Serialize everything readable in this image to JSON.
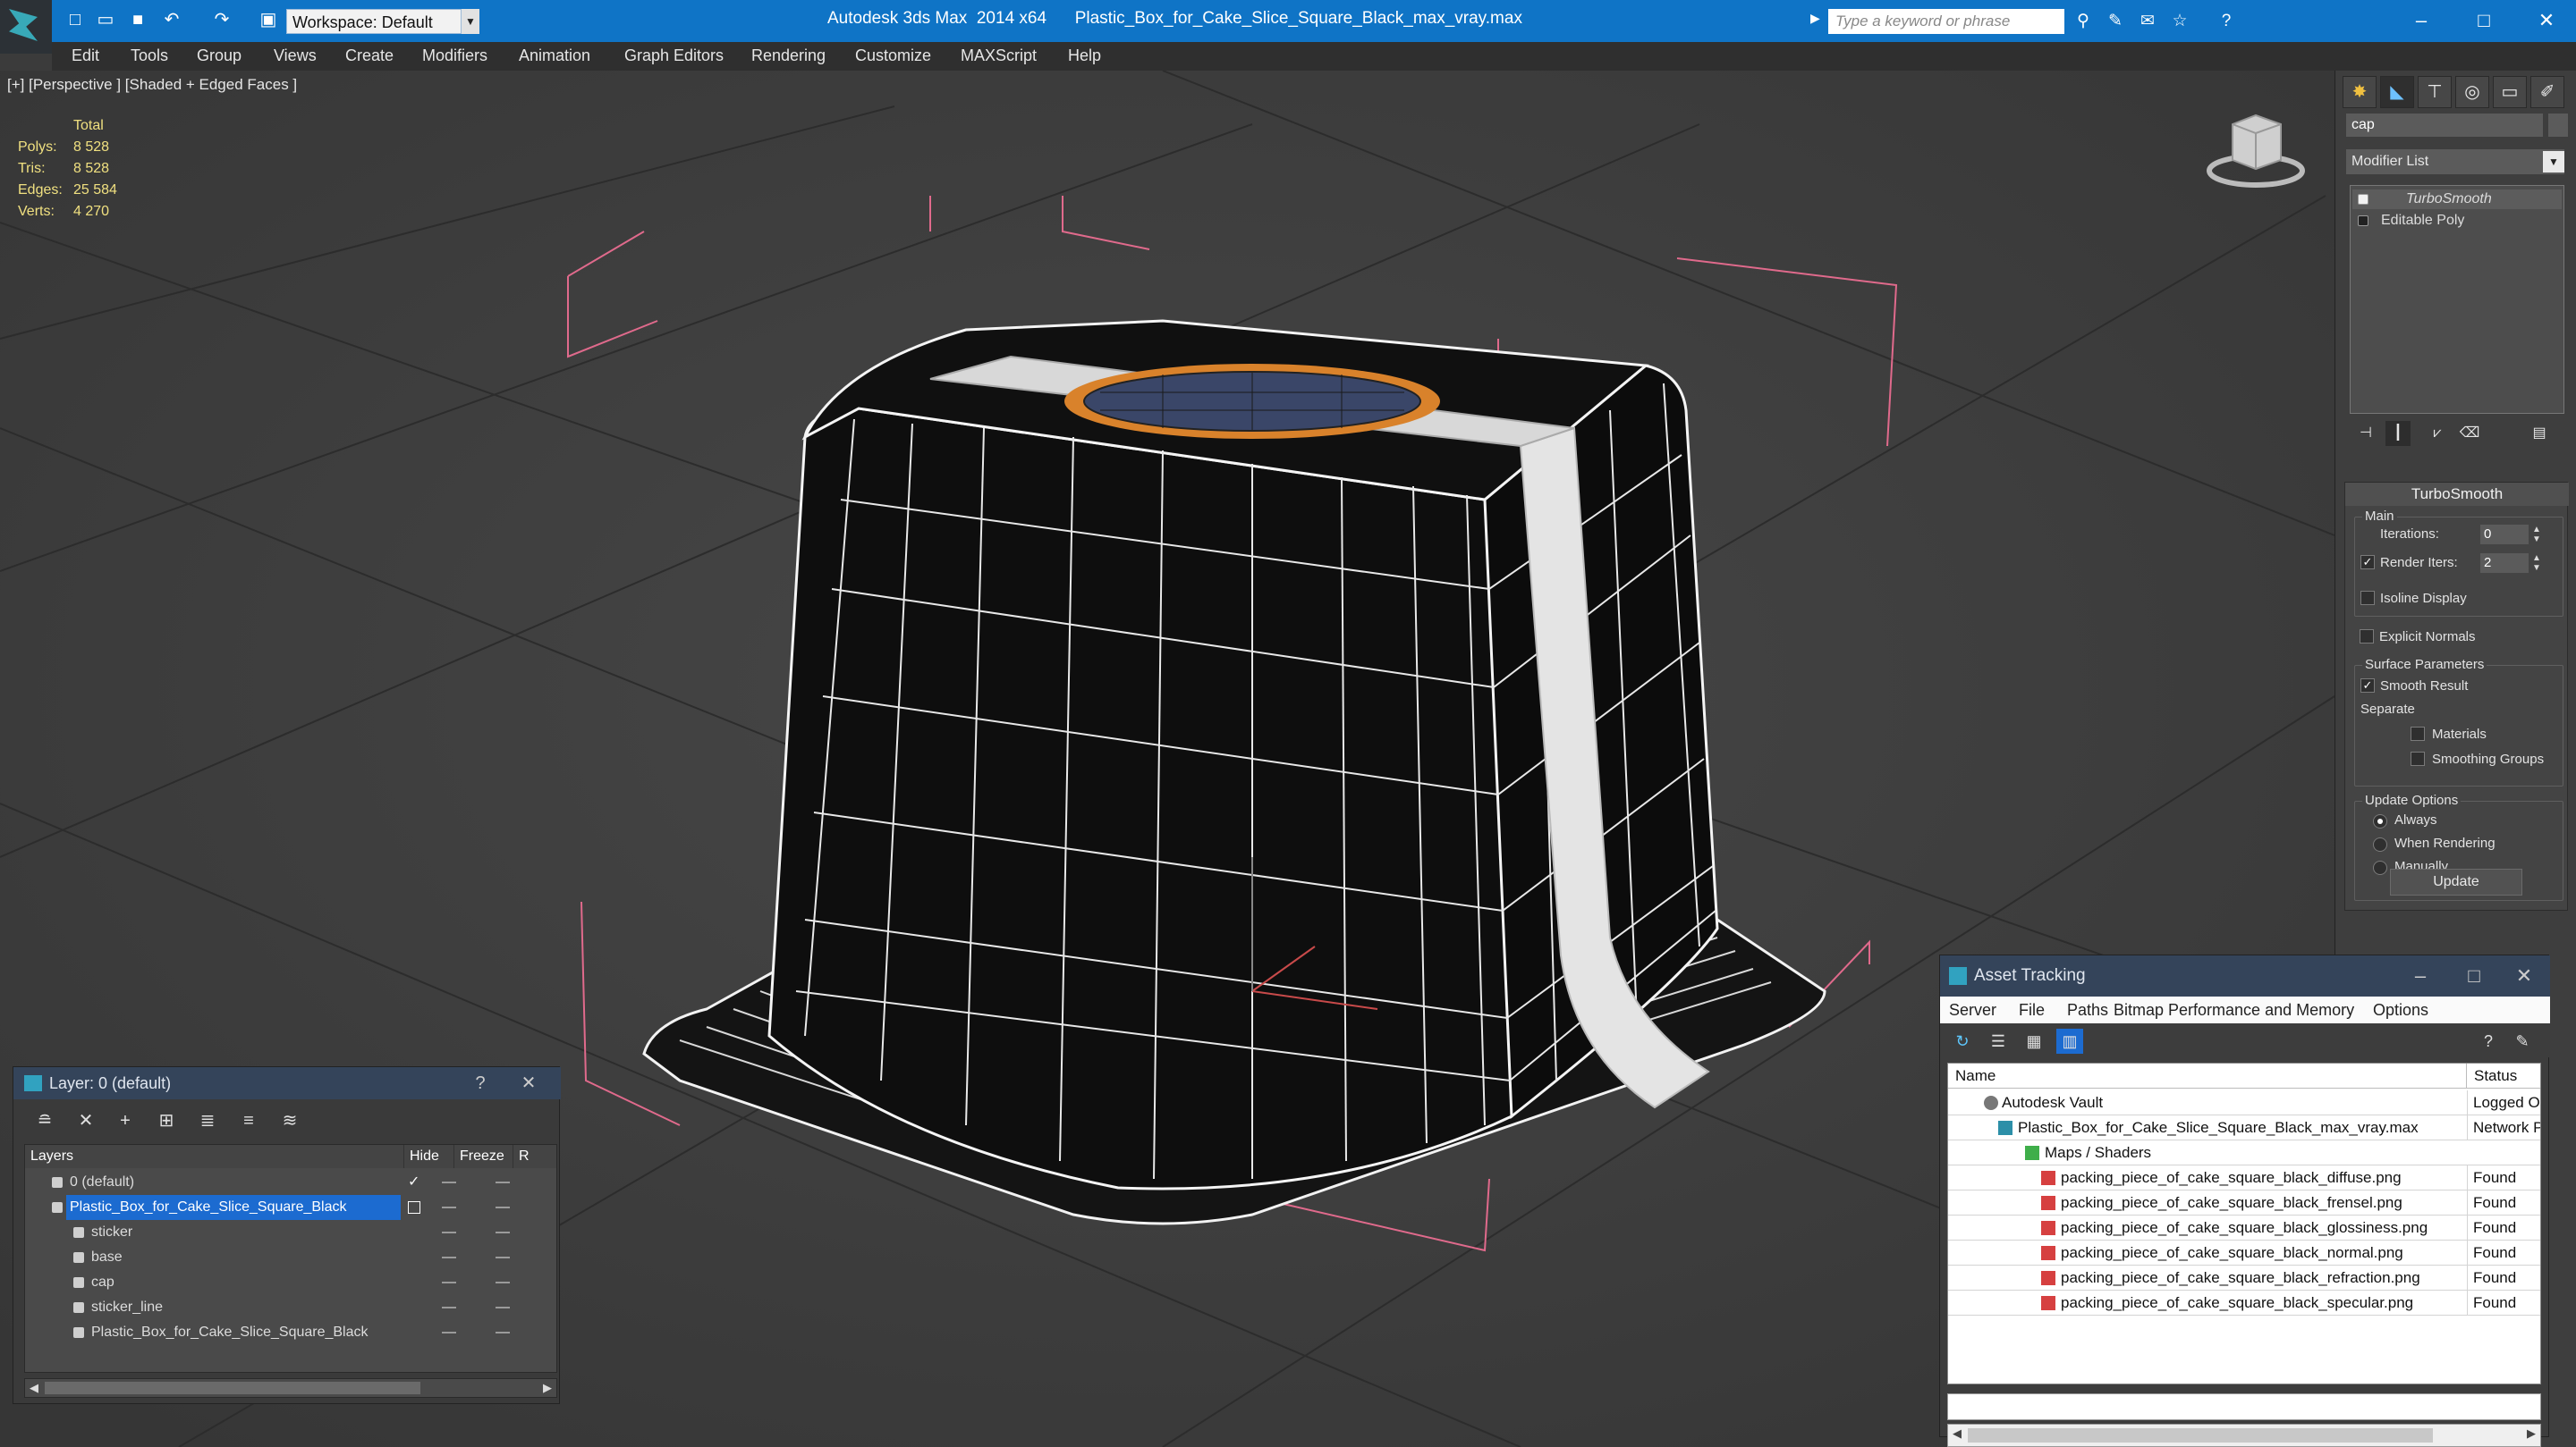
{
  "titlebar": {
    "workspace": "Workspace: Default",
    "app_title": "Autodesk 3ds Max  2014 x64      Plastic_Box_for_Cake_Slice_Square_Black_max_vray.max",
    "search_placeholder": "Type a keyword or phrase",
    "accent_color": "#0f74c6"
  },
  "menu": [
    "Edit",
    "Tools",
    "Group",
    "Views",
    "Create",
    "Modifiers",
    "Animation",
    "Graph Editors",
    "Rendering",
    "Customize",
    "MAXScript",
    "Help"
  ],
  "viewport": {
    "label": "[+] [Perspective ] [Shaded + Edged Faces ]",
    "stats": {
      "total_label": "Total",
      "rows": [
        {
          "key": "Polys:",
          "value": "8 528"
        },
        {
          "key": "Tris:",
          "value": "8 528"
        },
        {
          "key": "Edges:",
          "value": "25 584"
        },
        {
          "key": "Verts:",
          "value": "4 270"
        }
      ]
    }
  },
  "command_panel": {
    "object_name": "cap",
    "modifier_list": "Modifier List",
    "stack": [
      "TurboSmooth",
      "Editable Poly"
    ],
    "rollout_title": "TurboSmooth",
    "main_group": "Main",
    "iterations_label": "Iterations:",
    "iterations_value": "0",
    "render_iters_label": "Render Iters:",
    "render_iters_value": "2",
    "isoline_label": "Isoline Display",
    "explicit_normals_label": "Explicit Normals",
    "surface_group": "Surface Parameters",
    "smooth_result_label": "Smooth Result",
    "separate_label": "Separate",
    "materials_label": "Materials",
    "smoothing_groups_label": "Smoothing Groups",
    "update_group": "Update Options",
    "always_label": "Always",
    "when_rendering_label": "When Rendering",
    "manually_label": "Manually",
    "update_button": "Update"
  },
  "layer_window": {
    "title": "Layer: 0 (default)",
    "help": "?",
    "headers": {
      "layers": "Layers",
      "hide": "Hide",
      "freeze": "Freeze",
      "render": "R"
    },
    "rows": [
      {
        "name": "0 (default)"
      },
      {
        "name": "Plastic_Box_for_Cake_Slice_Square_Black"
      },
      {
        "name": "sticker"
      },
      {
        "name": "base"
      },
      {
        "name": "cap"
      },
      {
        "name": "sticker_line"
      },
      {
        "name": "Plastic_Box_for_Cake_Slice_Square_Black"
      }
    ]
  },
  "asset_window": {
    "title": "Asset Tracking",
    "menu": [
      "Server",
      "File",
      "Paths",
      "Bitmap Performance and Memory",
      "Options"
    ],
    "headers": {
      "name": "Name",
      "status": "Status"
    },
    "rows": [
      {
        "name": "Autodesk Vault",
        "status": "Logged Out"
      },
      {
        "name": "Plastic_Box_for_Cake_Slice_Square_Black_max_vray.max",
        "status": "Network Path"
      },
      {
        "name": "Maps / Shaders",
        "status": ""
      },
      {
        "name": "packing_piece_of_cake_square_black_diffuse.png",
        "status": "Found"
      },
      {
        "name": "packing_piece_of_cake_square_black_frensel.png",
        "status": "Found"
      },
      {
        "name": "packing_piece_of_cake_square_black_glossiness.png",
        "status": "Found"
      },
      {
        "name": "packing_piece_of_cake_square_black_normal.png",
        "status": "Found"
      },
      {
        "name": "packing_piece_of_cake_square_black_refraction.png",
        "status": "Found"
      },
      {
        "name": "packing_piece_of_cake_square_black_specular.png",
        "status": "Found"
      }
    ]
  }
}
